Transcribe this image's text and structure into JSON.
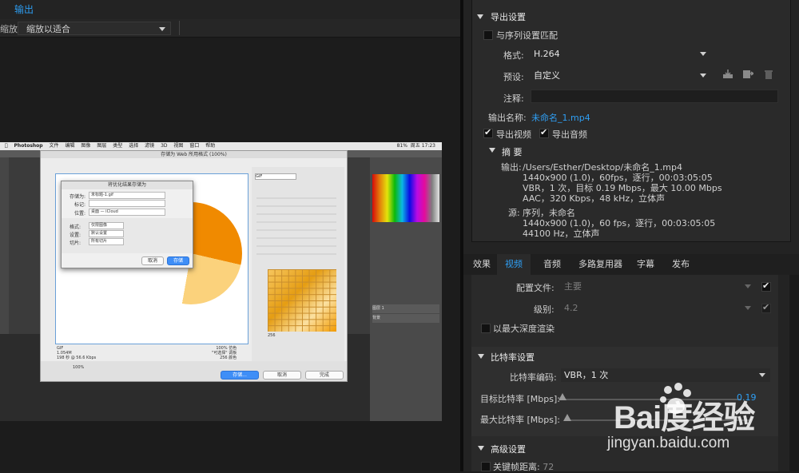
{
  "left_pane": {
    "tab": "输出",
    "zoom_label": "缩放:",
    "zoom_value": "缩放以适合"
  },
  "preview": {
    "menubar": [
      "Photoshop",
      "文件",
      "编辑",
      "图像",
      "图层",
      "类型",
      "选择",
      "滤镜",
      "3D",
      "视图",
      "窗口",
      "帮助"
    ],
    "clock": "周五 17:23",
    "battery": "81%",
    "sfw_title": "存储为 Web 所用格式 (100%)",
    "format": "GIF",
    "percent": "100%",
    "dialog": {
      "title": "将优化结果存储为",
      "save_as_label": "存储为:",
      "save_as_value": "未标题-1.gif",
      "tags_label": "标记:",
      "where_label": "位置:",
      "where_value": "桌面 — iCloud",
      "format_label": "格式:",
      "format_value": "仅限图像",
      "settings_label": "设置:",
      "settings_value": "默认设置",
      "slices_label": "切片:",
      "slices_value": "所有切片",
      "cancel": "取消",
      "save": "存储"
    },
    "sfw_buttons": {
      "save": "存储...",
      "cancel": "取消",
      "done": "完成"
    },
    "info_left": "GIF\n1.054M\n198 秒 @ 56.6 Kbps",
    "info_right": "100% 仿色\n\"可选择\" 调板\n256 颜色",
    "zoom_box": "100%",
    "colors": "256",
    "layers": [
      "图层 1",
      "背景"
    ]
  },
  "export": {
    "section_title": "导出设置",
    "match_sequence": "与序列设置匹配",
    "format_label": "格式:",
    "format_value": "H.264",
    "preset_label": "预设:",
    "preset_value": "自定义",
    "comment_label": "注释:",
    "output_name_label": "输出名称:",
    "output_name_value": "未命名_1.mp4",
    "export_video": "导出视频",
    "export_audio": "导出音频",
    "summary_title": "摘 要",
    "summary": {
      "output_label": "输出:",
      "output_lines": [
        "/Users/Esther/Desktop/未命名_1.mp4",
        "1440x900 (1.0)，60fps，逐行，00:03:05:05",
        "VBR，1 次，目标 0.19 Mbps，最大 10.00 Mbps",
        "AAC，320 Kbps，48  kHz，立体声"
      ],
      "source_label": "源:",
      "source_lines": [
        "序列，未命名",
        "1440x900 (1.0)，60 fps，逐行，00:03:05:05",
        "44100 Hz，立体声"
      ]
    },
    "icons": [
      "import-preset-icon",
      "save-preset-icon",
      "delete-preset-icon"
    ]
  },
  "tabs": [
    "效果",
    "视频",
    "音频",
    "多路复用器",
    "字幕",
    "发布"
  ],
  "active_tab": "视频",
  "video": {
    "profile_label": "配置文件:",
    "profile_value": "主要",
    "level_label": "级别:",
    "level_value": "4.2",
    "max_depth": "以最大深度渲染",
    "bitrate_section": "比特率设置",
    "bitrate_encoding_label": "比特率编码:",
    "bitrate_encoding_value": "VBR，1 次",
    "target_bitrate_label": "目标比特率 [Mbps]:",
    "target_bitrate_value": "0.19",
    "max_bitrate_label": "最大比特率 [Mbps]:",
    "advanced_section": "高级设置",
    "keyframe_label": "关键帧距离:",
    "keyframe_value": "72"
  },
  "watermark": {
    "logo": "Bai度经验",
    "url": "jingyan.baidu.com"
  },
  "colors": {
    "accent_blue": "#2f9ff4",
    "panel": "#2a2a2a",
    "background": "#1d1d1d"
  }
}
